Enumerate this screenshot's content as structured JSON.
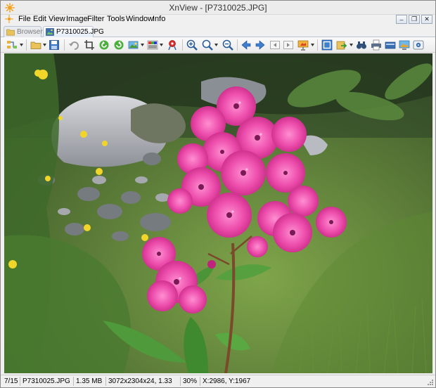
{
  "window": {
    "title": "XnView - [P7310025.JPG]"
  },
  "menu": {
    "items": [
      "File",
      "Edit",
      "View",
      "Image",
      "Filter",
      "Tools",
      "Window",
      "Info"
    ]
  },
  "tabs": [
    {
      "label": "Browser",
      "active": false
    },
    {
      "label": "P7310025.JPG",
      "active": true
    }
  ],
  "toolbar": {
    "icons": [
      "browser-icon",
      "open-folder-icon",
      "save-icon",
      "undo-icon",
      "crop-icon",
      "rotate-left-icon",
      "rotate-right-icon",
      "adjust-image-icon",
      "color-palette-icon",
      "red-eye-icon",
      "zoom-in-icon",
      "zoom-icon",
      "zoom-out-icon",
      "previous-icon",
      "next-icon",
      "first-page-icon",
      "last-page-icon",
      "slideshow-icon",
      "fullscreen-icon",
      "export-icon",
      "binoculars-icon",
      "print-icon",
      "scan-icon",
      "capture-icon",
      "webcam-icon"
    ]
  },
  "status": {
    "position": "7/15",
    "filename": "P7310025.JPG",
    "filesize": "1.35 MB",
    "dimensions": "3072x2304x24, 1.33",
    "zoom": "30%",
    "cursor": "X:2986, Y:1967"
  },
  "colors": {
    "accent": "#4a7fc0",
    "flower": "#e94aa8",
    "leaf": "#3f8a2e"
  }
}
